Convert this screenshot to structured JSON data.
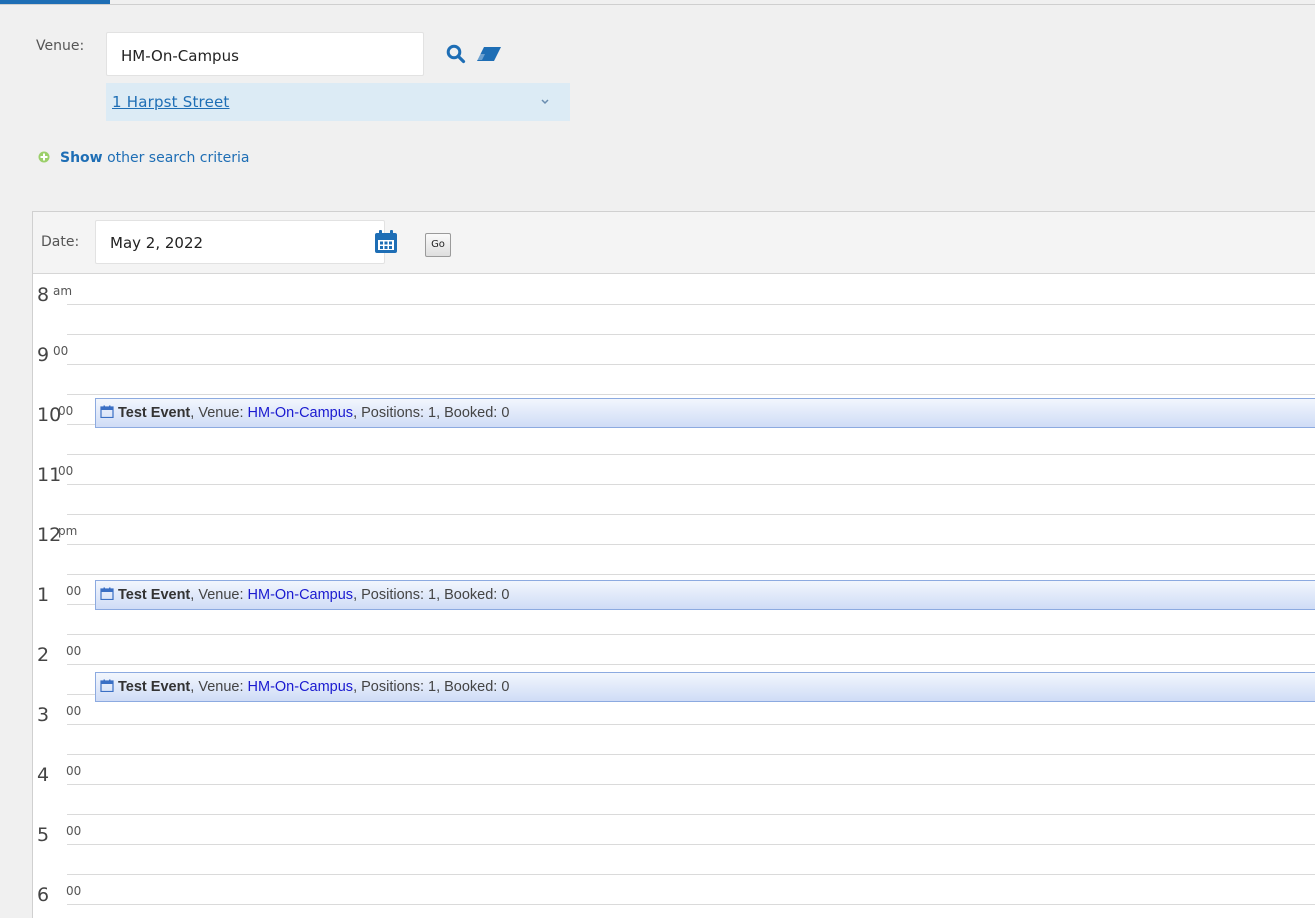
{
  "search": {
    "venue_label": "Venue:",
    "venue_value": "HM-On-Campus",
    "venue_address": "1 Harpst Street",
    "show_link": "Show",
    "show_rest": "other search criteria"
  },
  "calendar": {
    "date_label": "Date:",
    "date_value": "May 2, 2022",
    "go_label": "Go",
    "hours": [
      {
        "num": "8",
        "suffix": "am"
      },
      {
        "num": "9",
        "suffix": "00"
      },
      {
        "num": "10",
        "suffix": "00"
      },
      {
        "num": "11",
        "suffix": "00"
      },
      {
        "num": "12",
        "suffix": "pm"
      },
      {
        "num": "1",
        "suffix": "00"
      },
      {
        "num": "2",
        "suffix": "00"
      },
      {
        "num": "3",
        "suffix": "00"
      },
      {
        "num": "4",
        "suffix": "00"
      },
      {
        "num": "5",
        "suffix": "00"
      },
      {
        "num": "6",
        "suffix": "00"
      }
    ],
    "events": [
      {
        "title": "Test Event",
        "venue_prefix": ", Venue: ",
        "venue": "HM-On-Campus",
        "details": ", Positions: 1, Booked: 0"
      },
      {
        "title": "Test Event",
        "venue_prefix": ", Venue: ",
        "venue": "HM-On-Campus",
        "details": ", Positions: 1, Booked: 0"
      },
      {
        "title": "Test Event",
        "venue_prefix": ", Venue: ",
        "venue": "HM-On-Campus",
        "details": ", Positions: 1, Booked: 0"
      }
    ]
  },
  "colors": {
    "accent": "#1e6eb5",
    "event_border": "#8caae0",
    "event_fill": "#cfdcf6",
    "venue_link": "#1a1ad0"
  }
}
